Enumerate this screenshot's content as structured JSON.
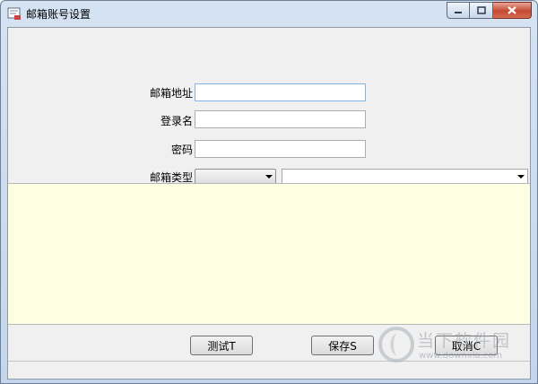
{
  "window": {
    "title": "邮箱账号设置",
    "icons": {
      "app": "mail-settings-icon",
      "minimize": "minimize-icon",
      "maximize": "maximize-icon",
      "close": "close-icon"
    }
  },
  "form": {
    "email_address_label": "邮箱地址",
    "email_address_value": "",
    "login_name_label": "登录名",
    "login_name_value": "",
    "password_label": "密码",
    "password_value": "",
    "mailbox_type_label": "邮箱类型",
    "mailbox_type_selected": "",
    "mailbox_server_selected": ""
  },
  "log": {
    "content": ""
  },
  "buttons": {
    "test": "测试T",
    "save": "保存S",
    "cancel": "取消C"
  },
  "watermark": {
    "title": "当下软件园",
    "url": "www.downxia.com"
  },
  "colors": {
    "log_background": "#ffffe2",
    "client_background": "#f0f0f0",
    "titlebar": "#c4d6ec",
    "close_button": "#c44a32"
  }
}
